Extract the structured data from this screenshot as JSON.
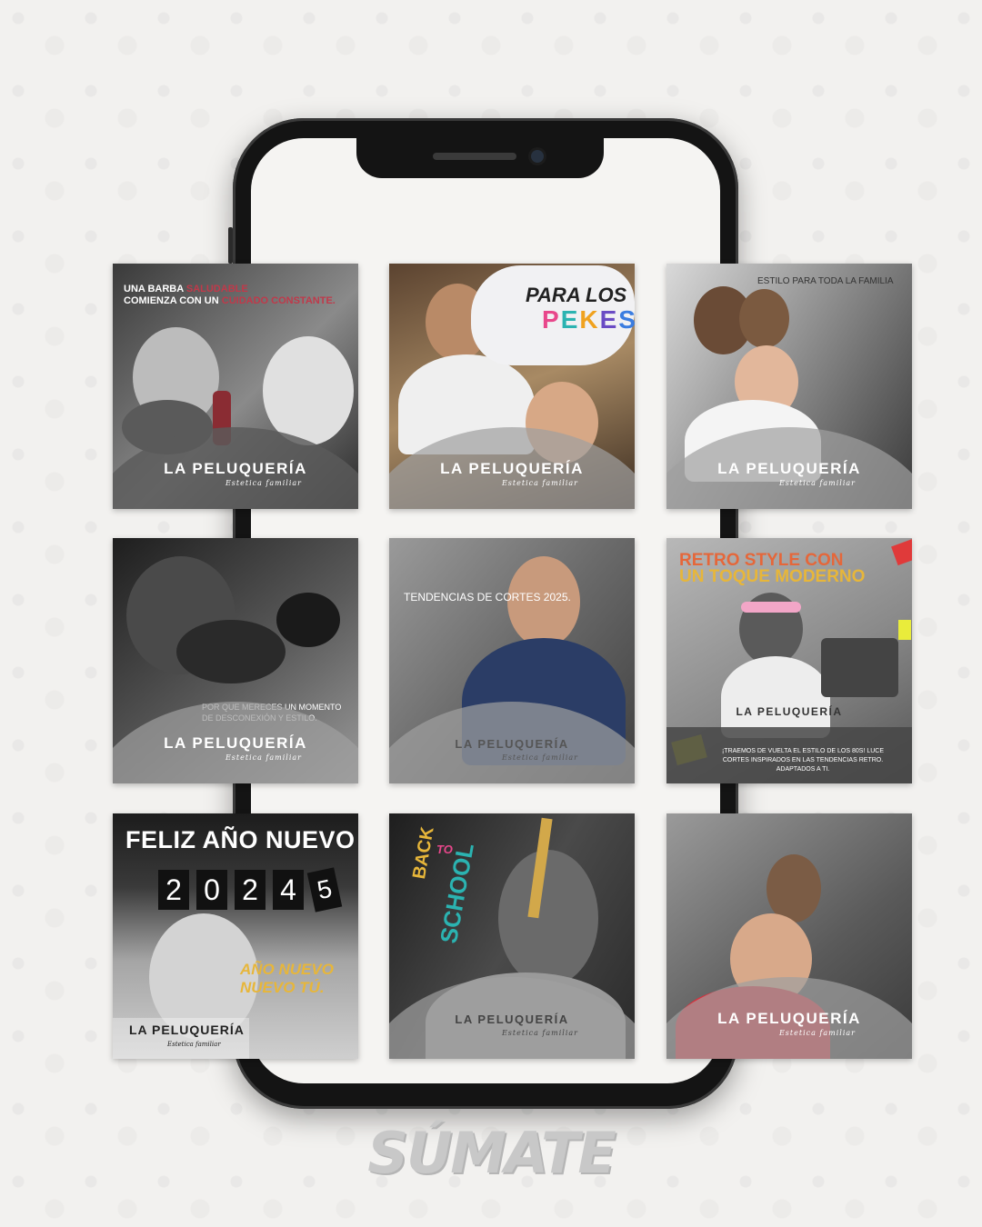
{
  "brand": {
    "name": "LA PELUQUERÍA",
    "tagline": "Estetica familiar"
  },
  "posts": [
    {
      "headline_1": "UNA BARBA",
      "headline_accent_1": "SALUDABLE",
      "headline_2": "COMIENZA CON UN",
      "headline_accent_2": "CUIDADO CONSTANTE."
    },
    {
      "headline_1": "PARA LOS",
      "headline_2": "PEKES"
    },
    {
      "headline": "ESTILO PARA TODA LA FAMILIA"
    },
    {
      "caption": "POR QUE MERECES UN MOMENTO DE DESCONEXIÓN Y ESTILO."
    },
    {
      "headline": "TENDENCIAS DE CORTES 2025."
    },
    {
      "headline_1": "RETRO STYLE CON",
      "headline_2": "UN TOQUE MODERNO",
      "caption": "¡TRAEMOS DE VUELTA EL ESTILO DE LOS 80S! LUCE CORTES INSPIRADOS EN LAS TENDENCIAS RETRO. ADAPTADOS A TI."
    },
    {
      "headline": "FELIZ AÑO NUEVO",
      "year": [
        "2",
        "0",
        "2",
        "4",
        "5"
      ],
      "tagline_1": "AÑO NUEVO",
      "tagline_2": "NUEVO TÚ."
    },
    {
      "headline_1": "BACK",
      "headline_2": "TO",
      "headline_3": "SCHOOL"
    },
    {}
  ],
  "footer_logo": "SÚMATE",
  "colors": {
    "accent_red": "#b0353d",
    "gold": "#e7b63a",
    "teal": "#2bb3b1",
    "pink": "#e8478b"
  }
}
